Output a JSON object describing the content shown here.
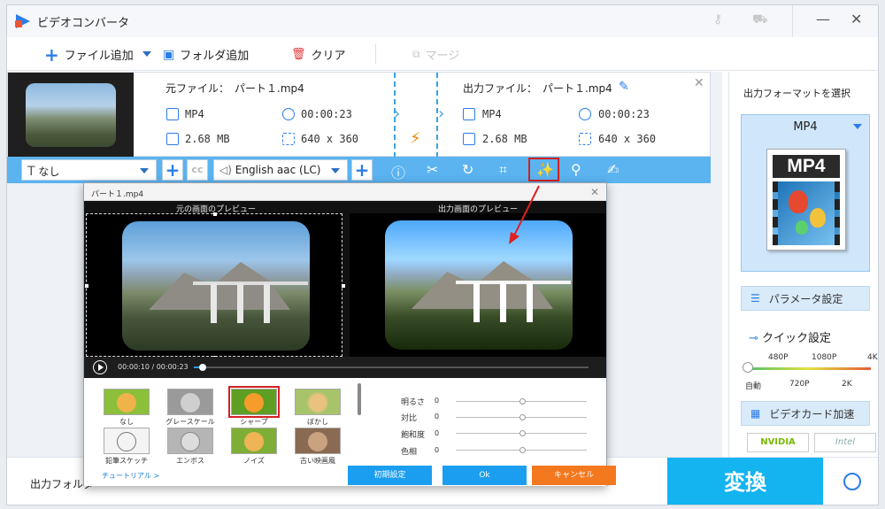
{
  "app": {
    "title": "ビデオコンバータ"
  },
  "toolbar": {
    "add_file": "ファイル追加",
    "add_folder": "フォルダ追加",
    "clear": "クリア",
    "merge": "マージ"
  },
  "file": {
    "source_label": "元ファイル：",
    "source_name": "パート１.mp4",
    "output_label": "出力ファイル：",
    "output_name": "パート１.mp4",
    "src_format": "MP4",
    "src_duration": "00:00:23",
    "src_size": "2.68 MB",
    "src_res": "640 x 360",
    "out_format": "MP4",
    "out_duration": "00:00:23",
    "out_size": "2.68 MB",
    "out_res": "640 x 360"
  },
  "editbar": {
    "subtitle": "なし",
    "audio": "English aac (LC)"
  },
  "right": {
    "format_title": "出力フォーマットを選択",
    "format_name": "MP4",
    "format_icon_text": "MP4",
    "params": "パラメータ設定",
    "quick": "クイック設定",
    "ticks_top": [
      "480P",
      "1080P",
      "4K"
    ],
    "ticks_bottom": [
      "自動",
      "720P",
      "2K"
    ],
    "gpu": "ビデオカード加速",
    "nvidia": "NVIDIA",
    "intel": "Intel"
  },
  "bottom": {
    "output_folder": "出力フォルダ",
    "convert": "変換"
  },
  "dialog": {
    "title": "パート１.mp4",
    "preview_original": "元の画面のプレビュー",
    "preview_output": "出力画面のプレビュー",
    "current_time": "00:00:10",
    "total_time": "00:00:23",
    "playback_progress": 0.43,
    "effects": [
      {
        "label": "なし"
      },
      {
        "label": "グレースケール"
      },
      {
        "label": "シャープ",
        "selected": true
      },
      {
        "label": "ぼかし"
      },
      {
        "label": "鉛筆スケッチ"
      },
      {
        "label": "エンボス"
      },
      {
        "label": "ノイズ"
      },
      {
        "label": "古い映画風"
      }
    ],
    "sliders": [
      {
        "label": "明るさ",
        "value": "0"
      },
      {
        "label": "対比",
        "value": "0"
      },
      {
        "label": "飽和度",
        "value": "0"
      },
      {
        "label": "色相",
        "value": "0"
      }
    ],
    "tutorial": "チュートリアル >",
    "reset": "初期設定",
    "ok": "Ok",
    "cancel": "キャンセル"
  },
  "colors": {
    "accent": "#2b7de9",
    "editbar": "#5bb3f0",
    "convert": "#13b4ef",
    "highlight": "#d42020",
    "cancel": "#f4781e",
    "ok": "#1b9ef0"
  }
}
